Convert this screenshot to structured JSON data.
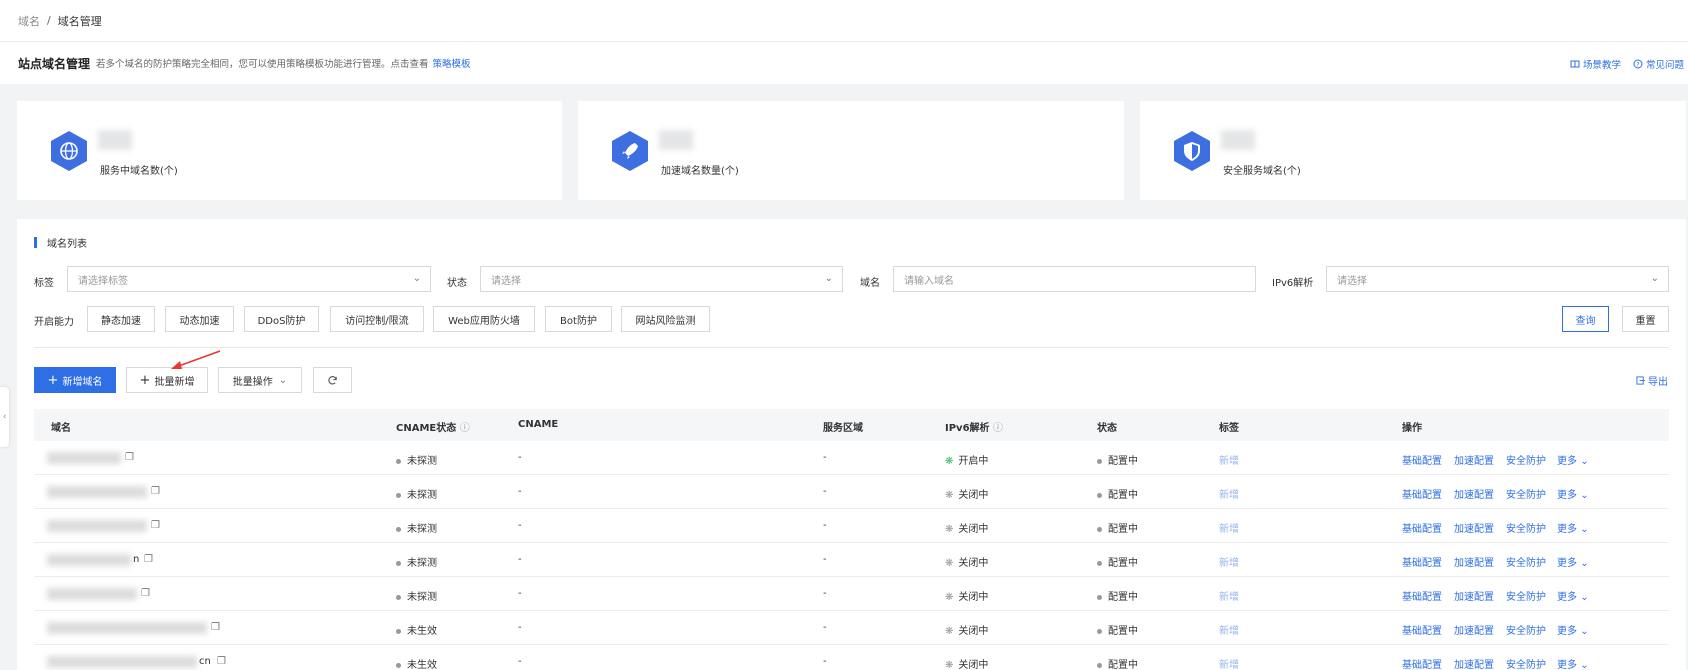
{
  "breadcrumb": {
    "root": "域名",
    "separator": "/",
    "current": "域名管理"
  },
  "subheader": {
    "title": "站点域名管理",
    "desc": "若多个域名的防护策略完全相同，您可以使用策略模板功能进行管理。点击查看",
    "link": "策略模板",
    "scene": "场景教学",
    "faq": "常见问题"
  },
  "cards": [
    {
      "label": "服务中域名数(个)",
      "icon": "globe-icon"
    },
    {
      "label": "加速域名数量(个)",
      "icon": "rocket-icon"
    },
    {
      "label": "安全服务域名(个)",
      "icon": "shield-icon"
    }
  ],
  "panel_title": "域名列表",
  "filters": {
    "tag_label": "标签",
    "tag_placeholder": "请选择标签",
    "status_label": "状态",
    "status_placeholder": "请选择",
    "domain_label": "域名",
    "domain_placeholder": "请输入域名",
    "ipv6_label": "IPv6解析",
    "ipv6_placeholder": "请选择",
    "ability_label": "开启能力",
    "abilities": [
      "静态加速",
      "动态加速",
      "DDoS防护",
      "访问控制/限流",
      "Web应用防火墙",
      "Bot防护",
      "网站风险监测"
    ],
    "query": "查询",
    "reset": "重置"
  },
  "toolbar": {
    "add": "新增域名",
    "batch_add": "批量新增",
    "batch_ops": "批量操作",
    "export": "导出"
  },
  "columns": [
    "域名",
    "CNAME状态",
    "CNAME",
    "服务区域",
    "IPv6解析",
    "状态",
    "标签",
    "操作"
  ],
  "rows": [
    {
      "cname_status": "未探测",
      "cname": "-",
      "region": "-",
      "ipv6": "开启中",
      "ipv6_on": true,
      "status": "配置中",
      "tag": "新增",
      "domain_suffix": "",
      "blur_w": 74
    },
    {
      "cname_status": "未探测",
      "cname": "-",
      "region": "-",
      "ipv6": "关闭中",
      "ipv6_on": false,
      "status": "配置中",
      "tag": "新增",
      "domain_suffix": "",
      "blur_w": 100
    },
    {
      "cname_status": "未探测",
      "cname": "-",
      "region": "-",
      "ipv6": "关闭中",
      "ipv6_on": false,
      "status": "配置中",
      "tag": "新增",
      "domain_suffix": "",
      "blur_w": 100
    },
    {
      "cname_status": "未探测",
      "cname": "-",
      "region": "-",
      "ipv6": "关闭中",
      "ipv6_on": false,
      "status": "配置中",
      "tag": "新增",
      "domain_suffix": "n",
      "blur_w": 84
    },
    {
      "cname_status": "未探测",
      "cname": "-",
      "region": "-",
      "ipv6": "关闭中",
      "ipv6_on": false,
      "status": "配置中",
      "tag": "新增",
      "domain_suffix": "",
      "blur_w": 90
    },
    {
      "cname_status": "未生效",
      "cname": "-",
      "region": "-",
      "ipv6": "关闭中",
      "ipv6_on": false,
      "status": "配置中",
      "tag": "新增",
      "domain_suffix": "",
      "blur_w": 160
    },
    {
      "cname_status": "未生效",
      "cname": "-",
      "region": "-",
      "ipv6": "关闭中",
      "ipv6_on": false,
      "status": "配置中",
      "tag": "新增",
      "domain_suffix": "cn",
      "blur_w": 150
    }
  ],
  "row_actions": {
    "basic": "基础配置",
    "accel": "加速配置",
    "security": "安全防护",
    "more": "更多"
  }
}
